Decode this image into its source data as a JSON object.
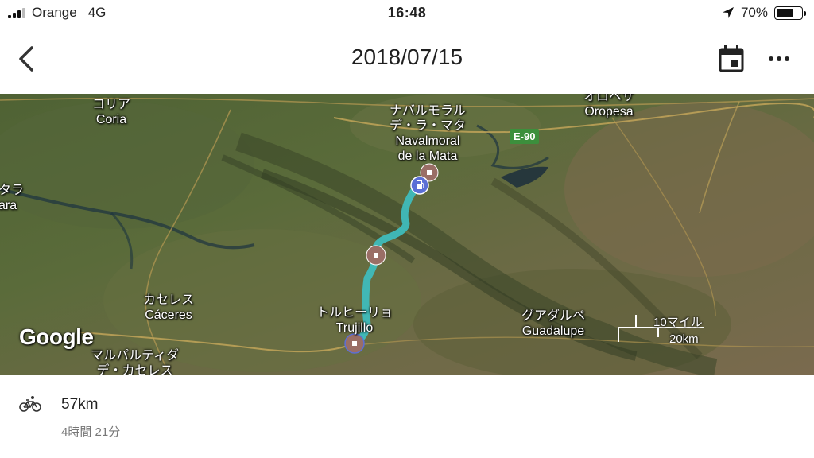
{
  "status_bar": {
    "carrier": "Orange",
    "network": "4G",
    "time": "16:48",
    "battery_percent": "70%",
    "battery_level": 0.7
  },
  "header": {
    "title": "2018/07/15",
    "back_icon": "chevron-left-icon",
    "calendar_icon": "calendar-icon",
    "more_icon": "more-horizontal-icon"
  },
  "map": {
    "labels": {
      "coria_jp": "コリア",
      "coria": "Coria",
      "navalmoral_jp_1": "ナバルモラル",
      "navalmoral_jp_2": "デ・ラ・マタ",
      "navalmoral_1": "Navalmoral",
      "navalmoral_2": "de la Mata",
      "oropesa_jp": "オロペサ",
      "oropesa": "Oropesa",
      "left_jp": "タラ",
      "left_en": "ara",
      "caceres_jp": "カセレス",
      "caceres": "Cáceres",
      "malpartida_jp_1": "マルパルティダ",
      "malpartida_jp_2": "デ・カセレス",
      "trujillo_jp": "トルヒーリョ",
      "trujillo": "Trujillo",
      "guadalupe_jp": "グアダルペ",
      "guadalupe": "Guadalupe"
    },
    "road_badge": "E-90",
    "logo": "Google",
    "scale_miles": "10マイル",
    "scale_km": "20km",
    "route_color": "#3fbcbc",
    "stop_marker_color": "#9a6e66",
    "fuel_marker_color": "#5b6fd6",
    "icons": [
      "stop-marker-icon",
      "fuel-station-icon"
    ]
  },
  "summary": {
    "activity_icon": "bicycle-icon",
    "distance": "57km",
    "duration": "4時間 21分"
  }
}
